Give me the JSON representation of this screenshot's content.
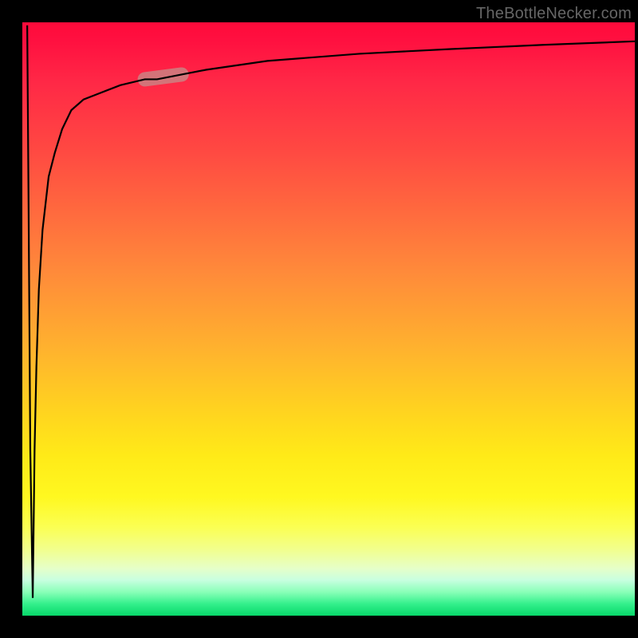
{
  "watermark": "TheBottleNecker.com",
  "chart_data": {
    "type": "line",
    "title": "",
    "xlabel": "",
    "ylabel": "",
    "xlim": [
      0,
      100
    ],
    "ylim": [
      0,
      100
    ],
    "x": [
      0.8,
      1.0,
      1.3,
      1.7,
      2.0,
      2.3,
      2.7,
      3.3,
      4.3,
      5.3,
      6.5,
      8.0,
      10.0,
      12.5,
      16.0,
      20.0,
      22.0,
      26.0,
      30.0,
      40.0,
      55.0,
      70.0,
      85.0,
      100.0
    ],
    "values": [
      99.5,
      72.0,
      28.0,
      3.0,
      28.0,
      42.0,
      55.0,
      65.0,
      74.0,
      78.0,
      82.0,
      85.2,
      87.0,
      88.0,
      89.4,
      90.4,
      90.4,
      91.2,
      92.0,
      93.5,
      94.7,
      95.5,
      96.2,
      96.8
    ],
    "marker": {
      "x_range": [
        20,
        26
      ],
      "y_range": [
        90.4,
        91.2
      ]
    },
    "background_gradient": {
      "top": "#ff0a3a",
      "mid_upper": "#ff8a3a",
      "mid": "#ffe018",
      "mid_lower": "#f1ff90",
      "bottom": "#08d86a"
    }
  }
}
